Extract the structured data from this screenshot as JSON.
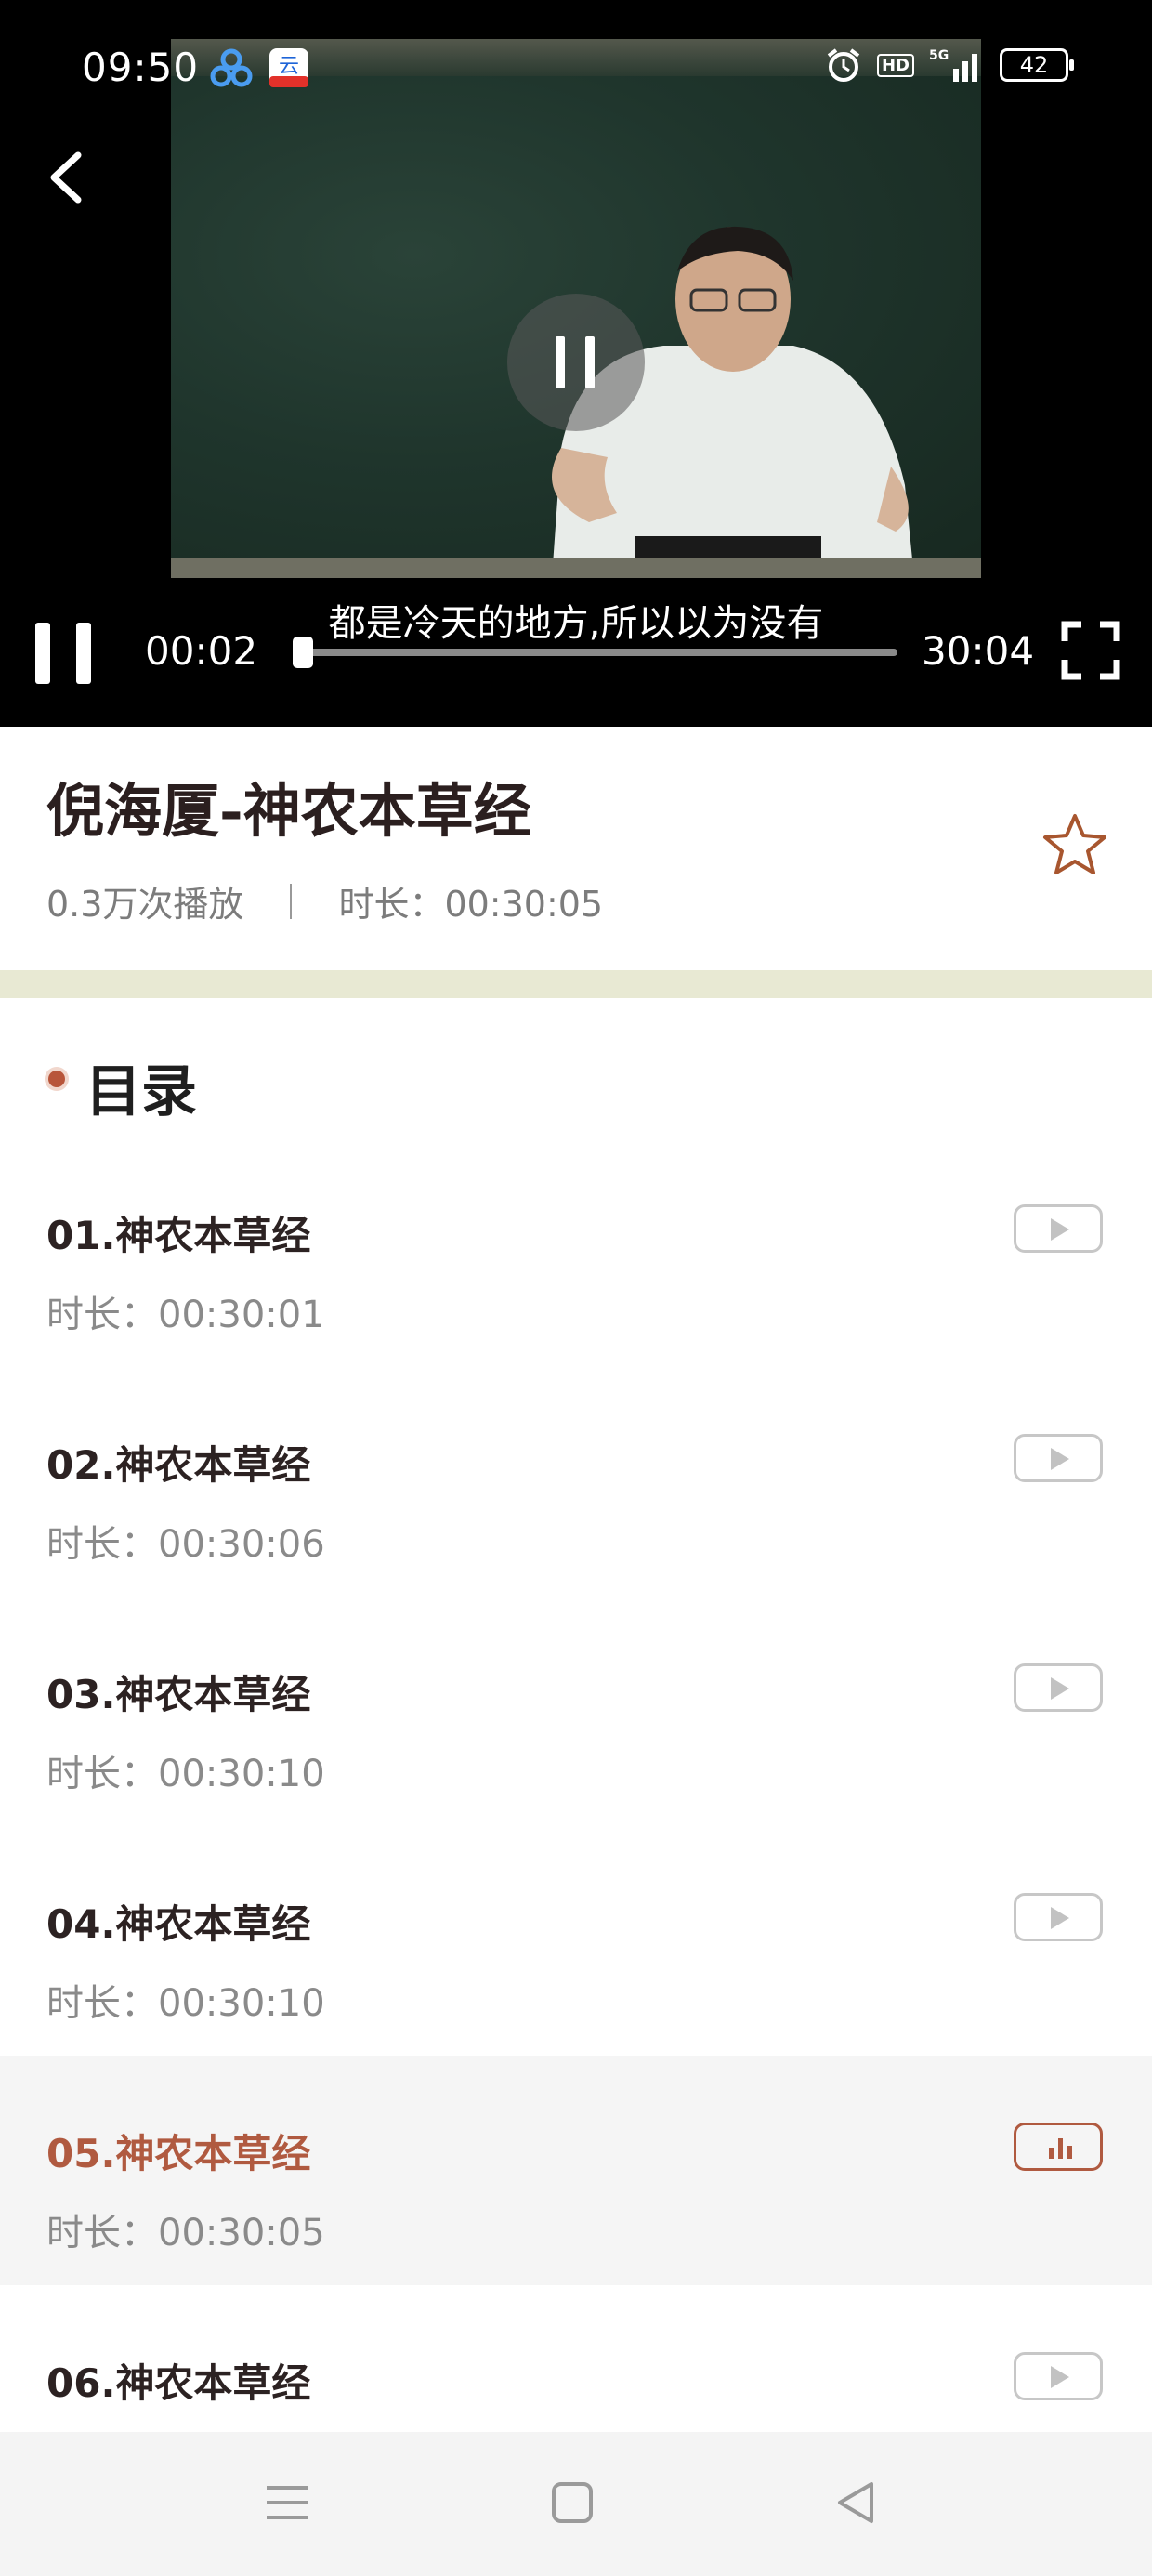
{
  "status_bar": {
    "time": "09:50",
    "battery": "42",
    "network": "5G",
    "hd_label": "HD"
  },
  "player": {
    "subtitle": "都是冷天的地方,所以以为没有",
    "current_time": "00:02",
    "total_time": "30:04",
    "progress_fraction": 0.001,
    "state": "playing"
  },
  "course": {
    "title": "倪海厦-神农本草经",
    "play_count": "0.3万次播放",
    "duration_label": "时长：00:30:05",
    "favorite_icon": "star-outline-icon"
  },
  "catalog": {
    "heading": "目录",
    "episodes": [
      {
        "title": "01.神农本草经",
        "duration": "时长：00:30:01",
        "active": false
      },
      {
        "title": "02.神农本草经",
        "duration": "时长：00:30:06",
        "active": false
      },
      {
        "title": "03.神农本草经",
        "duration": "时长：00:30:10",
        "active": false
      },
      {
        "title": "04.神农本草经",
        "duration": "时长：00:30:10",
        "active": false
      },
      {
        "title": "05.神农本草经",
        "duration": "时长：00:30:05",
        "active": true
      },
      {
        "title": "06.神农本草经",
        "duration": "",
        "active": false
      }
    ]
  },
  "colors": {
    "accent": "#b05a40",
    "divider_band": "#e8e9d3",
    "active_row_bg": "#f5f5f5"
  },
  "nav_icons": [
    "menu-icon",
    "home-square-icon",
    "back-triangle-icon"
  ]
}
